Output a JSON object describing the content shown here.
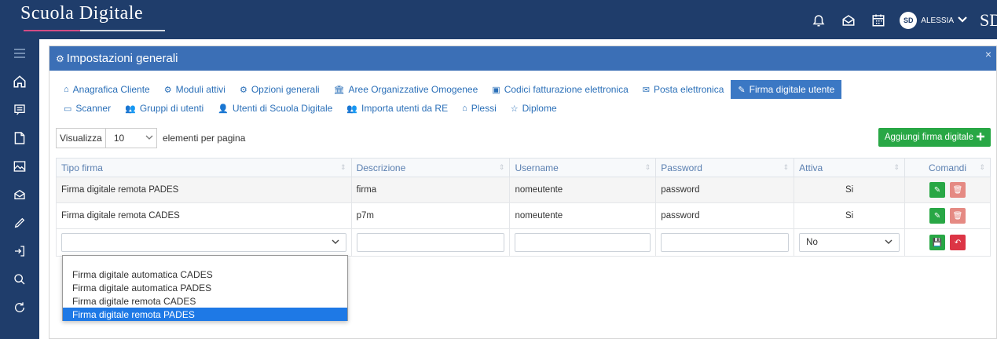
{
  "header": {
    "brand": "Scuola Digitale",
    "logo_right": "SD",
    "user_name": "ALESSIA",
    "avatar_initials": "SD",
    "icons": [
      "bell-icon",
      "mail-open-icon",
      "calendar-icon",
      "chevron-down-icon"
    ]
  },
  "sidebar": {
    "icons": [
      "menu-icon",
      "home-icon",
      "chat-icon",
      "document-icon",
      "image-icon",
      "mail-icon",
      "pencil-icon",
      "login-icon",
      "search-icon",
      "refresh-icon"
    ]
  },
  "panel": {
    "title": "Impostazioni generali",
    "close": "×"
  },
  "tabs": {
    "row1": [
      {
        "label": "Anagrafica Cliente",
        "icon": "⌂"
      },
      {
        "label": "Moduli attivi",
        "icon": "⚙"
      },
      {
        "label": "Opzioni generali",
        "icon": "⚙"
      },
      {
        "label": "Aree Organizzative Omogenee",
        "icon": "🏛"
      },
      {
        "label": "Codici fatturazione elettronica",
        "icon": "▣"
      },
      {
        "label": "Posta elettronica",
        "icon": "✉"
      },
      {
        "label": "Firma digitale utente",
        "icon": "✎",
        "active": true
      }
    ],
    "row2": [
      {
        "label": "Scanner",
        "icon": "▭"
      },
      {
        "label": "Gruppi di utenti",
        "icon": "👥"
      },
      {
        "label": "Utenti di Scuola Digitale",
        "icon": "👤"
      },
      {
        "label": "Importa utenti da RE",
        "icon": "👥"
      },
      {
        "label": "Plessi",
        "icon": "⌂"
      },
      {
        "label": "Diplome",
        "icon": "☆"
      }
    ]
  },
  "toolbar": {
    "show_label": "Visualizza",
    "page_size": "10",
    "per_page_text": "elementi per pagina",
    "add_button": "Aggiungi firma digitale"
  },
  "table": {
    "headers": [
      "Tipo firma",
      "Descrizione",
      "Username",
      "Password",
      "Attiva",
      "Comandi"
    ],
    "rows": [
      {
        "tipo": "Firma digitale remota PADES",
        "descrizione": "firma",
        "username": "nomeutente",
        "password": "password",
        "attiva": "Si"
      },
      {
        "tipo": "Firma digitale remota CADES",
        "descrizione": "p7m",
        "username": "nomeutente",
        "password": "password",
        "attiva": "Si"
      }
    ],
    "edit_row": {
      "tipo": "",
      "descrizione": "",
      "username": "",
      "password": "",
      "attiva": "No"
    }
  },
  "dropdown": {
    "options": [
      "Firma digitale automatica CADES",
      "Firma digitale automatica PADES",
      "Firma digitale remota CADES",
      "Firma digitale remota PADES"
    ],
    "selected_index": 3
  },
  "colors": {
    "topbar": "#1f3d6b",
    "panel_header": "#3b6fb6",
    "active_tab": "#3b78c4",
    "success": "#28a745",
    "danger": "#dc3545",
    "selected_option": "#1e79e6"
  }
}
